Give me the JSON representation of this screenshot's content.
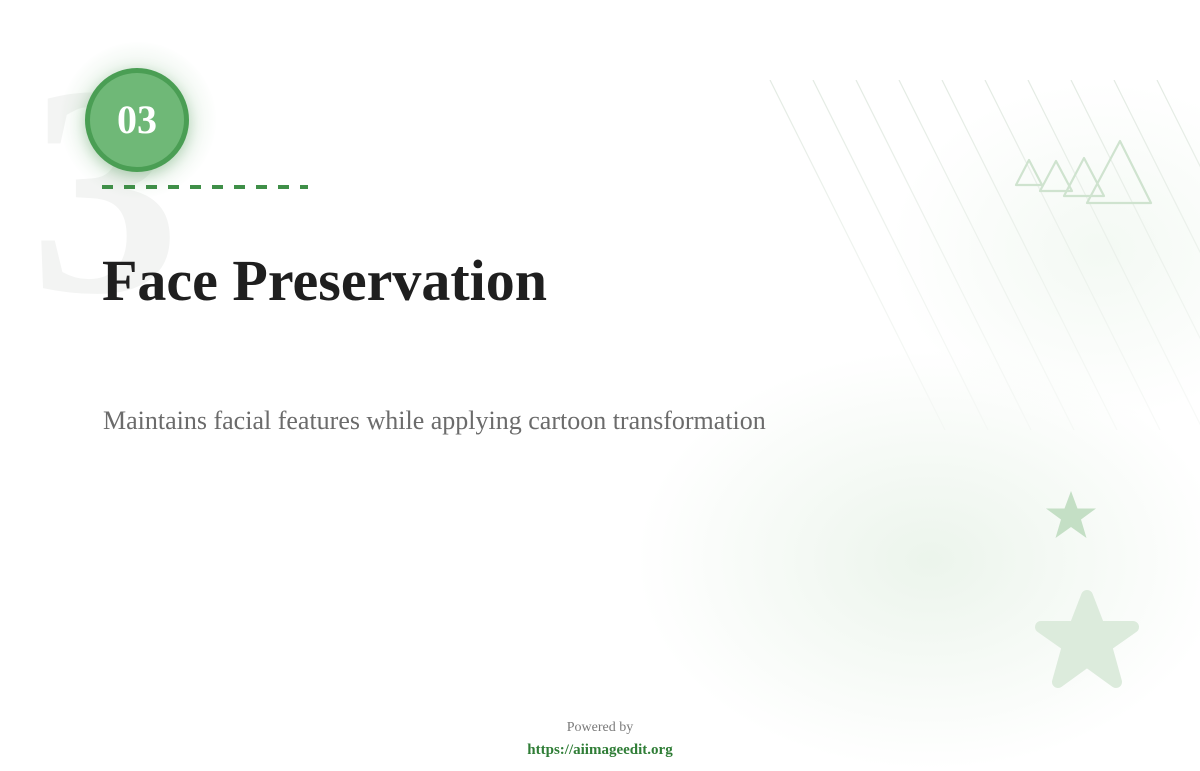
{
  "feature": {
    "number": "03",
    "watermark_digit": "3",
    "title": "Face Preservation",
    "description": "Maintains facial features while applying cartoon transformation"
  },
  "footer": {
    "powered_by": "Powered by",
    "link": "https://aiimageedit.org"
  },
  "colors": {
    "accent_green": "#4a9e54",
    "badge_fill": "#6fb877",
    "dash_green": "#3f8f48",
    "link_green": "#2f7d36",
    "title_text": "#1f1f1f",
    "body_text": "#6b6b6b",
    "decoration_green": "#cfe5d0"
  },
  "decorations": {
    "stripes": "diagonal-stripes-pattern",
    "triangles": "triangle-outline-icon",
    "star_small": "star-icon",
    "star_large": "rounded-star-icon"
  }
}
